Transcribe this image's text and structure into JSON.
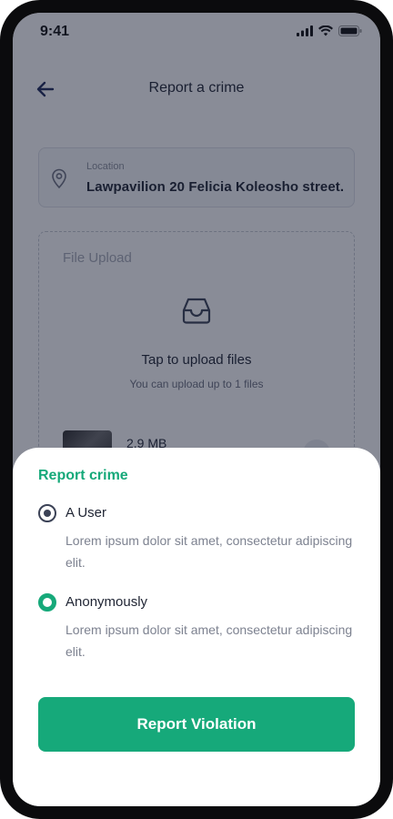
{
  "status_bar": {
    "time": "9:41"
  },
  "header": {
    "title": "Report a crime"
  },
  "location": {
    "label": "Location",
    "value": "Lawpavilion 20 Felicia Koleosho street..."
  },
  "upload": {
    "label": "File Upload",
    "title": "Tap to upload files",
    "subtitle": "You can upload up to 1 files",
    "file_size": "2.9 MB"
  },
  "sheet": {
    "title": "Report crime",
    "options": [
      {
        "label": "A User",
        "description": "Lorem ipsum dolor sit amet, consectetur adipiscing elit."
      },
      {
        "label": "Anonymously",
        "description": "Lorem ipsum dolor sit amet, consectetur adipiscing elit."
      }
    ],
    "button_label": "Report Violation"
  },
  "colors": {
    "accent": "#16a97a",
    "overlay": "#141a30",
    "text": "#1f2433",
    "muted": "#7d8290"
  }
}
